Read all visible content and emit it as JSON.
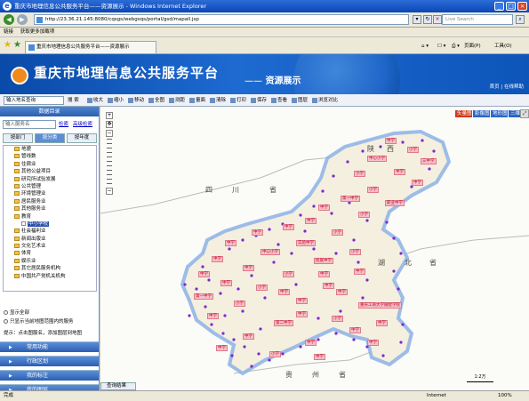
{
  "window": {
    "title": "重庆市地理信息公共服务平台——资源展示 - Windows Internet Explorer"
  },
  "address": {
    "url": "http://23.36.21.145:8080/cqsgs/webgsqs/portal/gsd/mapall.jsp",
    "search_placeholder": "Live Search"
  },
  "links_bar": {
    "label": "链接",
    "item": "获取更多加载项"
  },
  "tab": {
    "label": "重庆市地理信息公共服务平台——资源展示"
  },
  "ie_tools": {
    "page": "页面(P)",
    "tools": "工具(O)"
  },
  "banner": {
    "title": "重庆市地理信息公共服务平台",
    "subtitle_dash": "——",
    "subtitle": "资源展示",
    "links": "首页 | 在线帮助"
  },
  "toolbar": {
    "place_placeholder": "输入地名查询",
    "search_btn": "搜 索",
    "tools": [
      "收大",
      "缩小",
      "移动",
      "全图",
      "测距",
      "量面",
      "清除",
      "打印",
      "保存",
      "查看",
      "图层",
      "浏览对比"
    ]
  },
  "sidebar": {
    "header": "数据目录",
    "search_placeholder": "输入服务名",
    "search_link": "检索",
    "adv_link": "高级检索",
    "tabs": [
      "按部门",
      "按分类",
      "按年度"
    ],
    "active_tab": 1,
    "tree": [
      {
        "label": "地貌",
        "type": "folder"
      },
      {
        "label": "管线数",
        "type": "folder"
      },
      {
        "label": "住宿业",
        "type": "folder"
      },
      {
        "label": "其他公益项目",
        "type": "folder"
      },
      {
        "label": "研究所试验发展",
        "type": "folder"
      },
      {
        "label": "公共管理",
        "type": "folder"
      },
      {
        "label": "环境管理业",
        "type": "folder"
      },
      {
        "label": "居民服务业",
        "type": "folder"
      },
      {
        "label": "其他服务业",
        "type": "folder"
      },
      {
        "label": "教育",
        "type": "folder"
      },
      {
        "label": "中小学校",
        "type": "box",
        "selected": true
      },
      {
        "label": "社会福利业",
        "type": "folder"
      },
      {
        "label": "新闻出版业",
        "type": "folder"
      },
      {
        "label": "文化艺术业",
        "type": "folder"
      },
      {
        "label": "体育",
        "type": "folder"
      },
      {
        "label": "娱乐业",
        "type": "folder"
      },
      {
        "label": "其它居民服务机构",
        "type": "folder"
      },
      {
        "label": "中国共产党机关机构",
        "type": "folder"
      }
    ],
    "radio1": "显示全部",
    "radio2": "只显示当前地图范围内的服务",
    "tip": "提示：点击图服名，添加图层到地图",
    "sections": [
      "常用功能",
      "行政区划",
      "我的标注",
      "我的图层"
    ]
  },
  "map": {
    "layer_buttons": [
      {
        "label": "矢量图",
        "color": "#d23a1a"
      },
      {
        "label": "影像图",
        "color": "#2a67c8"
      },
      {
        "label": "地形图",
        "color": "#2a67c8"
      },
      {
        "label": "三维图",
        "color": "#2a67c8"
      }
    ],
    "regions": [
      "四",
      "川",
      "省",
      "湖",
      "北",
      "省",
      "贵",
      "州",
      "省",
      "陕",
      "西"
    ],
    "labels": [
      "中学",
      "小学",
      "中心小学",
      "三中学",
      "中学",
      "小学",
      "中学",
      "小学",
      "第一中学",
      "职业中学",
      "中学",
      "小学",
      "中学",
      "中学",
      "中学",
      "小学",
      "中学",
      "实验中学",
      "中心小学",
      "小学",
      "中学",
      "民族中学",
      "中学",
      "小学",
      "中学",
      "中学",
      "小学",
      "中学",
      "重庆工商大学融智学院",
      "第一中学",
      "小学",
      "中学",
      "小学",
      "中学",
      "第二中学",
      "中学",
      "中学",
      "中学",
      "中学",
      "中学",
      "小学",
      "中学",
      "中学",
      "中学",
      "中学",
      "中学",
      "中学",
      "中学"
    ],
    "scale_label": "1:2万",
    "bottom_tab": "查询结果"
  },
  "status": {
    "left": "完成",
    "zone": "Internet",
    "zoom": "100%"
  }
}
